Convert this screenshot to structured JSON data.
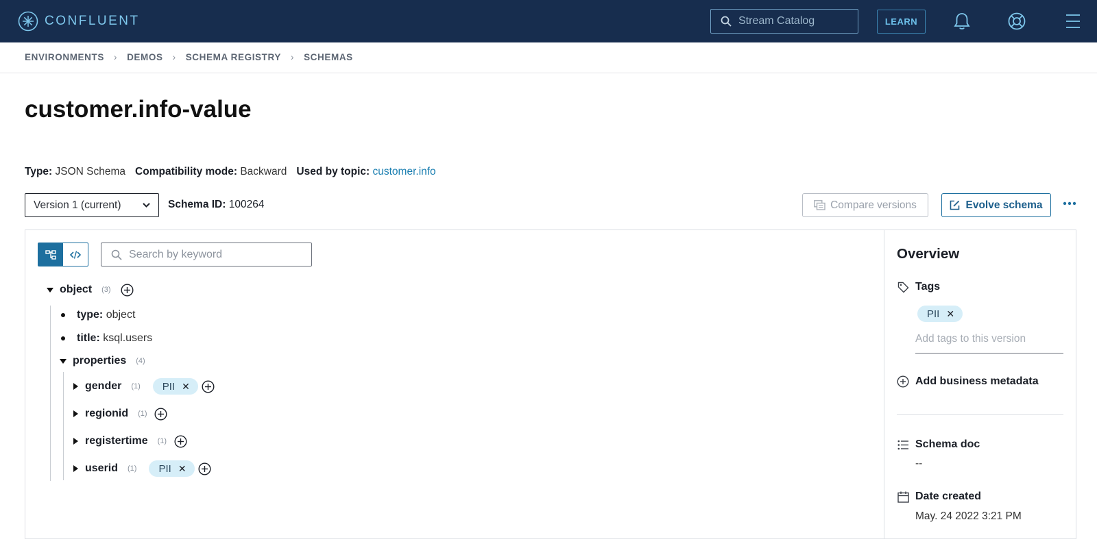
{
  "app": {
    "brand": "CONFLUENT",
    "search_placeholder": "Stream Catalog",
    "learn_label": "LEARN"
  },
  "breadcrumb": [
    "ENVIRONMENTS",
    "DEMOS",
    "SCHEMA REGISTRY",
    "SCHEMAS"
  ],
  "page": {
    "title": "customer.info-value",
    "type_label": "Type:",
    "type_value": "JSON Schema",
    "compat_label": "Compatibility mode:",
    "compat_value": "Backward",
    "topic_label": "Used by topic:",
    "topic_value": "customer.info",
    "version_selected": "Version 1 (current)",
    "schema_id_label": "Schema ID:",
    "schema_id_value": "100264",
    "compare_label": "Compare versions",
    "evolve_label": "Evolve schema"
  },
  "tree": {
    "search_placeholder": "Search by keyword",
    "root": {
      "key": "object",
      "count": "(3)"
    },
    "attrs": [
      {
        "key": "type:",
        "value": "object"
      },
      {
        "key": "title:",
        "value": "ksql.users"
      }
    ],
    "properties": {
      "key": "properties",
      "count": "(4)"
    },
    "fields": [
      {
        "key": "gender",
        "count": "(1)",
        "tag": "PII"
      },
      {
        "key": "regionid",
        "count": "(1)",
        "tag": ""
      },
      {
        "key": "registertime",
        "count": "(1)",
        "tag": ""
      },
      {
        "key": "userid",
        "count": "(1)",
        "tag": "PII"
      }
    ]
  },
  "overview": {
    "title": "Overview",
    "tags_label": "Tags",
    "tag": "PII",
    "add_tags_placeholder": "Add tags to this version",
    "add_metadata_label": "Add business metadata",
    "schema_doc_label": "Schema doc",
    "schema_doc_value": "--",
    "date_created_label": "Date created",
    "date_created_value": "May. 24 2022 3:21 PM"
  },
  "colors": {
    "nav_bg": "#172d4e",
    "accent": "#1d6f9f",
    "tag_bg": "#d6eef8",
    "link": "#1b7fb1"
  }
}
